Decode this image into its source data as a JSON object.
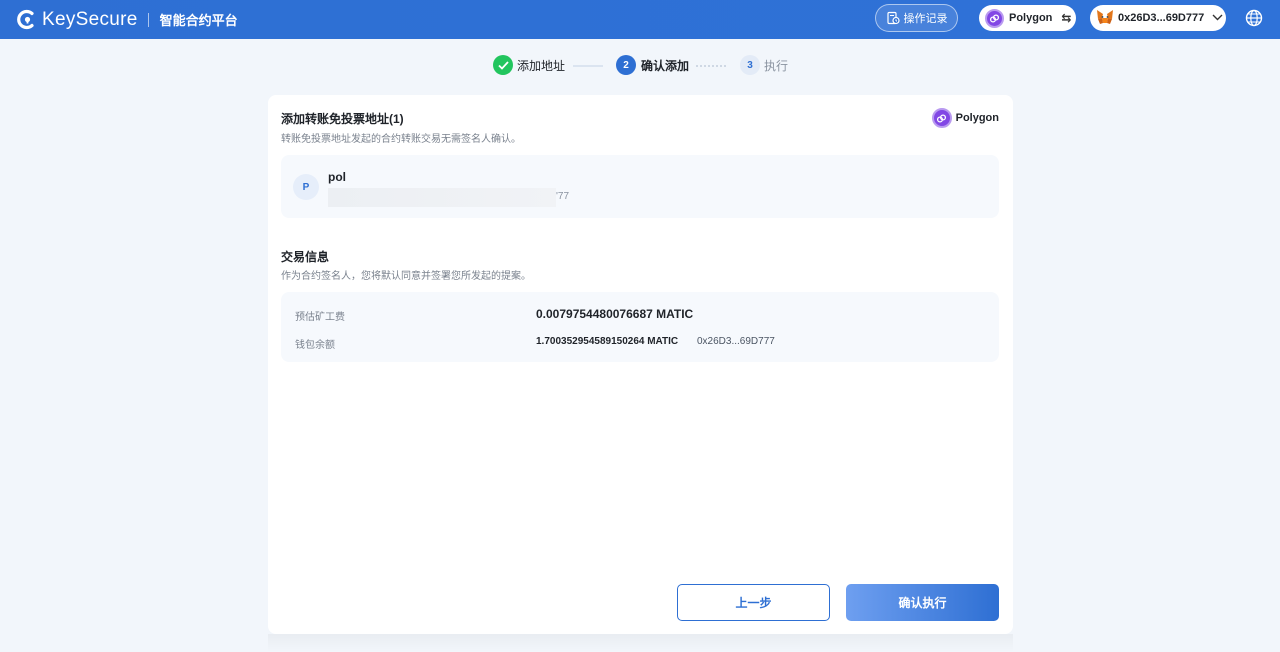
{
  "header": {
    "brand": "KeySecure",
    "platform": "智能合约平台",
    "ops_label": "操作记录",
    "network": "Polygon",
    "wallet_address": "0x26D3...69D777"
  },
  "stepper": {
    "steps": [
      {
        "index": "1",
        "label": "添加地址",
        "state": "done"
      },
      {
        "index": "2",
        "label": "确认添加",
        "state": "active"
      },
      {
        "index": "3",
        "label": "执行",
        "state": "pending"
      }
    ]
  },
  "section_add": {
    "title": "添加转账免投票地址(1)",
    "subtitle": "转账免投票地址发起的合约转账交易无需签名人确认。",
    "network_badge": "Polygon",
    "address": {
      "avatar": "P",
      "name": "pol",
      "address_tail": "'77"
    }
  },
  "section_tx": {
    "title": "交易信息",
    "subtitle": "作为合约签名人，您将默认同意并签署您所发起的提案。",
    "fee_label": "预估矿工费",
    "fee_value": "0.0079754480076687 MATIC",
    "balance_label": "钱包余额",
    "balance_value": "1.700352954589150264 MATIC",
    "balance_address": "0x26D3...69D777"
  },
  "actions": {
    "prev_label": "上一步",
    "exec_label": "确认执行"
  },
  "colors": {
    "brand": "#2e6fd3",
    "success": "#22c55e",
    "polygon": "#8247e5"
  }
}
